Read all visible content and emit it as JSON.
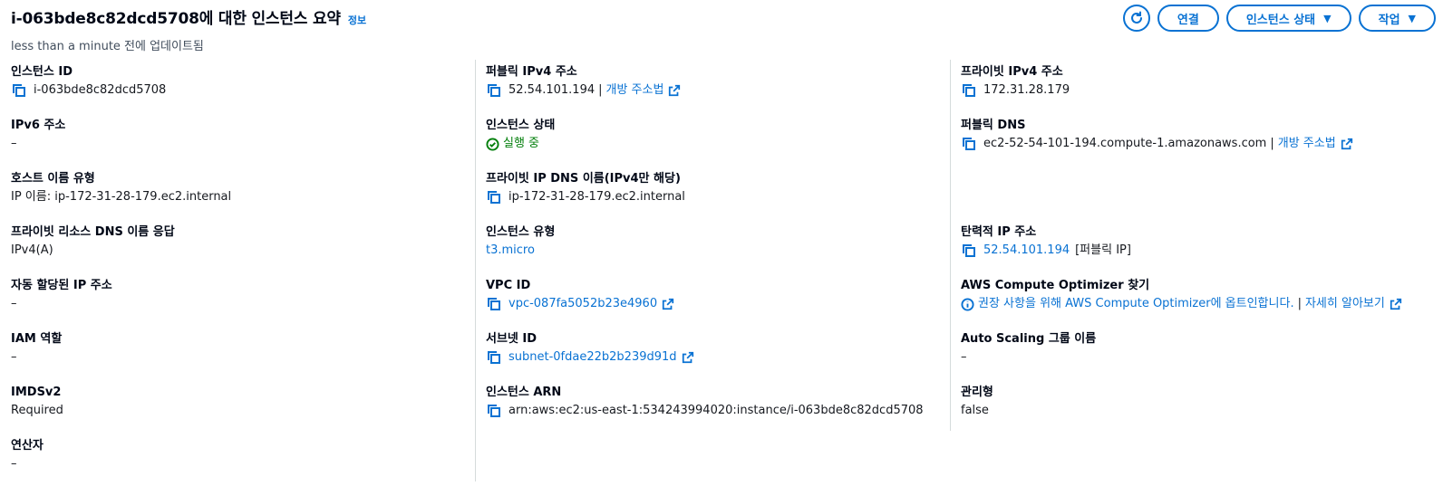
{
  "header": {
    "title": "i-063bde8c82dcd5708에 대한 인스턴스 요약",
    "info_link": "정보",
    "subtitle": "less than a minute 전에 업데이트됨",
    "actions": {
      "refresh_icon": "refresh-icon",
      "connect": "연결",
      "instance_state": "인스턴스 상태",
      "actions": "작업"
    }
  },
  "col1": {
    "instance_id": {
      "label": "인스턴스 ID",
      "value": "i-063bde8c82dcd5708"
    },
    "ipv6": {
      "label": "IPv6 주소",
      "value": "–"
    },
    "hostname_type": {
      "label": "호스트 이름 유형",
      "value": "IP 이름: ip-172-31-28-179.ec2.internal"
    },
    "private_dns_answer": {
      "label": "프라이빗 리소스 DNS 이름 응답",
      "value": "IPv4(A)"
    },
    "auto_ip": {
      "label": "자동 할당된 IP 주소",
      "value": "–"
    },
    "iam_role": {
      "label": "IAM 역할",
      "value": "–"
    },
    "imdsv2": {
      "label": "IMDSv2",
      "value": "Required"
    },
    "operator": {
      "label": "연산자",
      "value": "–"
    }
  },
  "col2": {
    "public_ipv4": {
      "label": "퍼블릭 IPv4 주소",
      "value": "52.54.101.194",
      "sep": "|",
      "link": "개방 주소법"
    },
    "instance_state": {
      "label": "인스턴스 상태",
      "value": "실행 중"
    },
    "private_ip_dns": {
      "label": "프라이빗 IP DNS 이름(IPv4만 해당)",
      "value": "ip-172-31-28-179.ec2.internal"
    },
    "instance_type": {
      "label": "인스턴스 유형",
      "value": "t3.micro"
    },
    "vpc_id": {
      "label": "VPC ID",
      "value": "vpc-087fa5052b23e4960"
    },
    "subnet_id": {
      "label": "서브넷 ID",
      "value": "subnet-0fdae22b2b239d91d"
    },
    "instance_arn": {
      "label": "인스턴스 ARN",
      "value": "arn:aws:ec2:us-east-1:534243994020:instance/i-063bde8c82dcd5708"
    }
  },
  "col3": {
    "private_ipv4": {
      "label": "프라이빗 IPv4 주소",
      "value": "172.31.28.179"
    },
    "public_dns": {
      "label": "퍼블릭 DNS",
      "value": "ec2-52-54-101-194.compute-1.amazonaws.com",
      "sep": "|",
      "link": "개방 주소법"
    },
    "elastic_ip": {
      "label": "탄력적 IP 주소",
      "value": "52.54.101.194",
      "tag": "[퍼블릭 IP]"
    },
    "compute_optimizer": {
      "label": "AWS Compute Optimizer 찾기",
      "value": "권장 사항을 위해 AWS Compute Optimizer에 옵트인합니다.",
      "sep": "|",
      "link": "자세히 알아보기"
    },
    "asg_name": {
      "label": "Auto Scaling 그룹 이름",
      "value": "–"
    },
    "managed": {
      "label": "관리형",
      "value": "false"
    }
  },
  "colors": {
    "link": "#0972d3",
    "success": "#037f0c",
    "text": "#16191f",
    "divider": "#d5dbdb"
  }
}
